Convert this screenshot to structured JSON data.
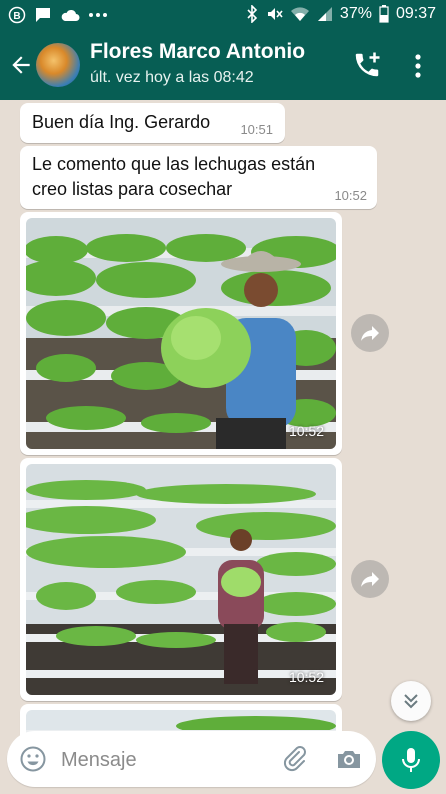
{
  "status_bar": {
    "battery": "37%",
    "time": "09:37",
    "icons_left": [
      "b-badge-icon",
      "chat-icon",
      "cloud-icon",
      "more-dots-icon"
    ],
    "icons_right": [
      "bluetooth-icon",
      "mute-icon",
      "wifi-icon",
      "signal-icon",
      "battery-icon"
    ]
  },
  "header": {
    "contact_name": "Flores Marco Antonio",
    "last_seen": "últ. vez hoy a las 08:42",
    "actions": [
      "add-call-icon",
      "menu-icon"
    ]
  },
  "messages": [
    {
      "type": "text",
      "text": "Buen día Ing. Gerardo",
      "time": "10:51"
    },
    {
      "type": "text",
      "lines": [
        "Le comento que las lechugas están",
        "creo listas para cosechar"
      ],
      "time": "10:52"
    },
    {
      "type": "image",
      "time": "10:52"
    },
    {
      "type": "image",
      "time": "10:52"
    }
  ],
  "composer": {
    "placeholder": "Mensaje"
  },
  "colors": {
    "header": "#075e54",
    "chat_background": "#e6ddd4",
    "send_button": "#00a884"
  }
}
